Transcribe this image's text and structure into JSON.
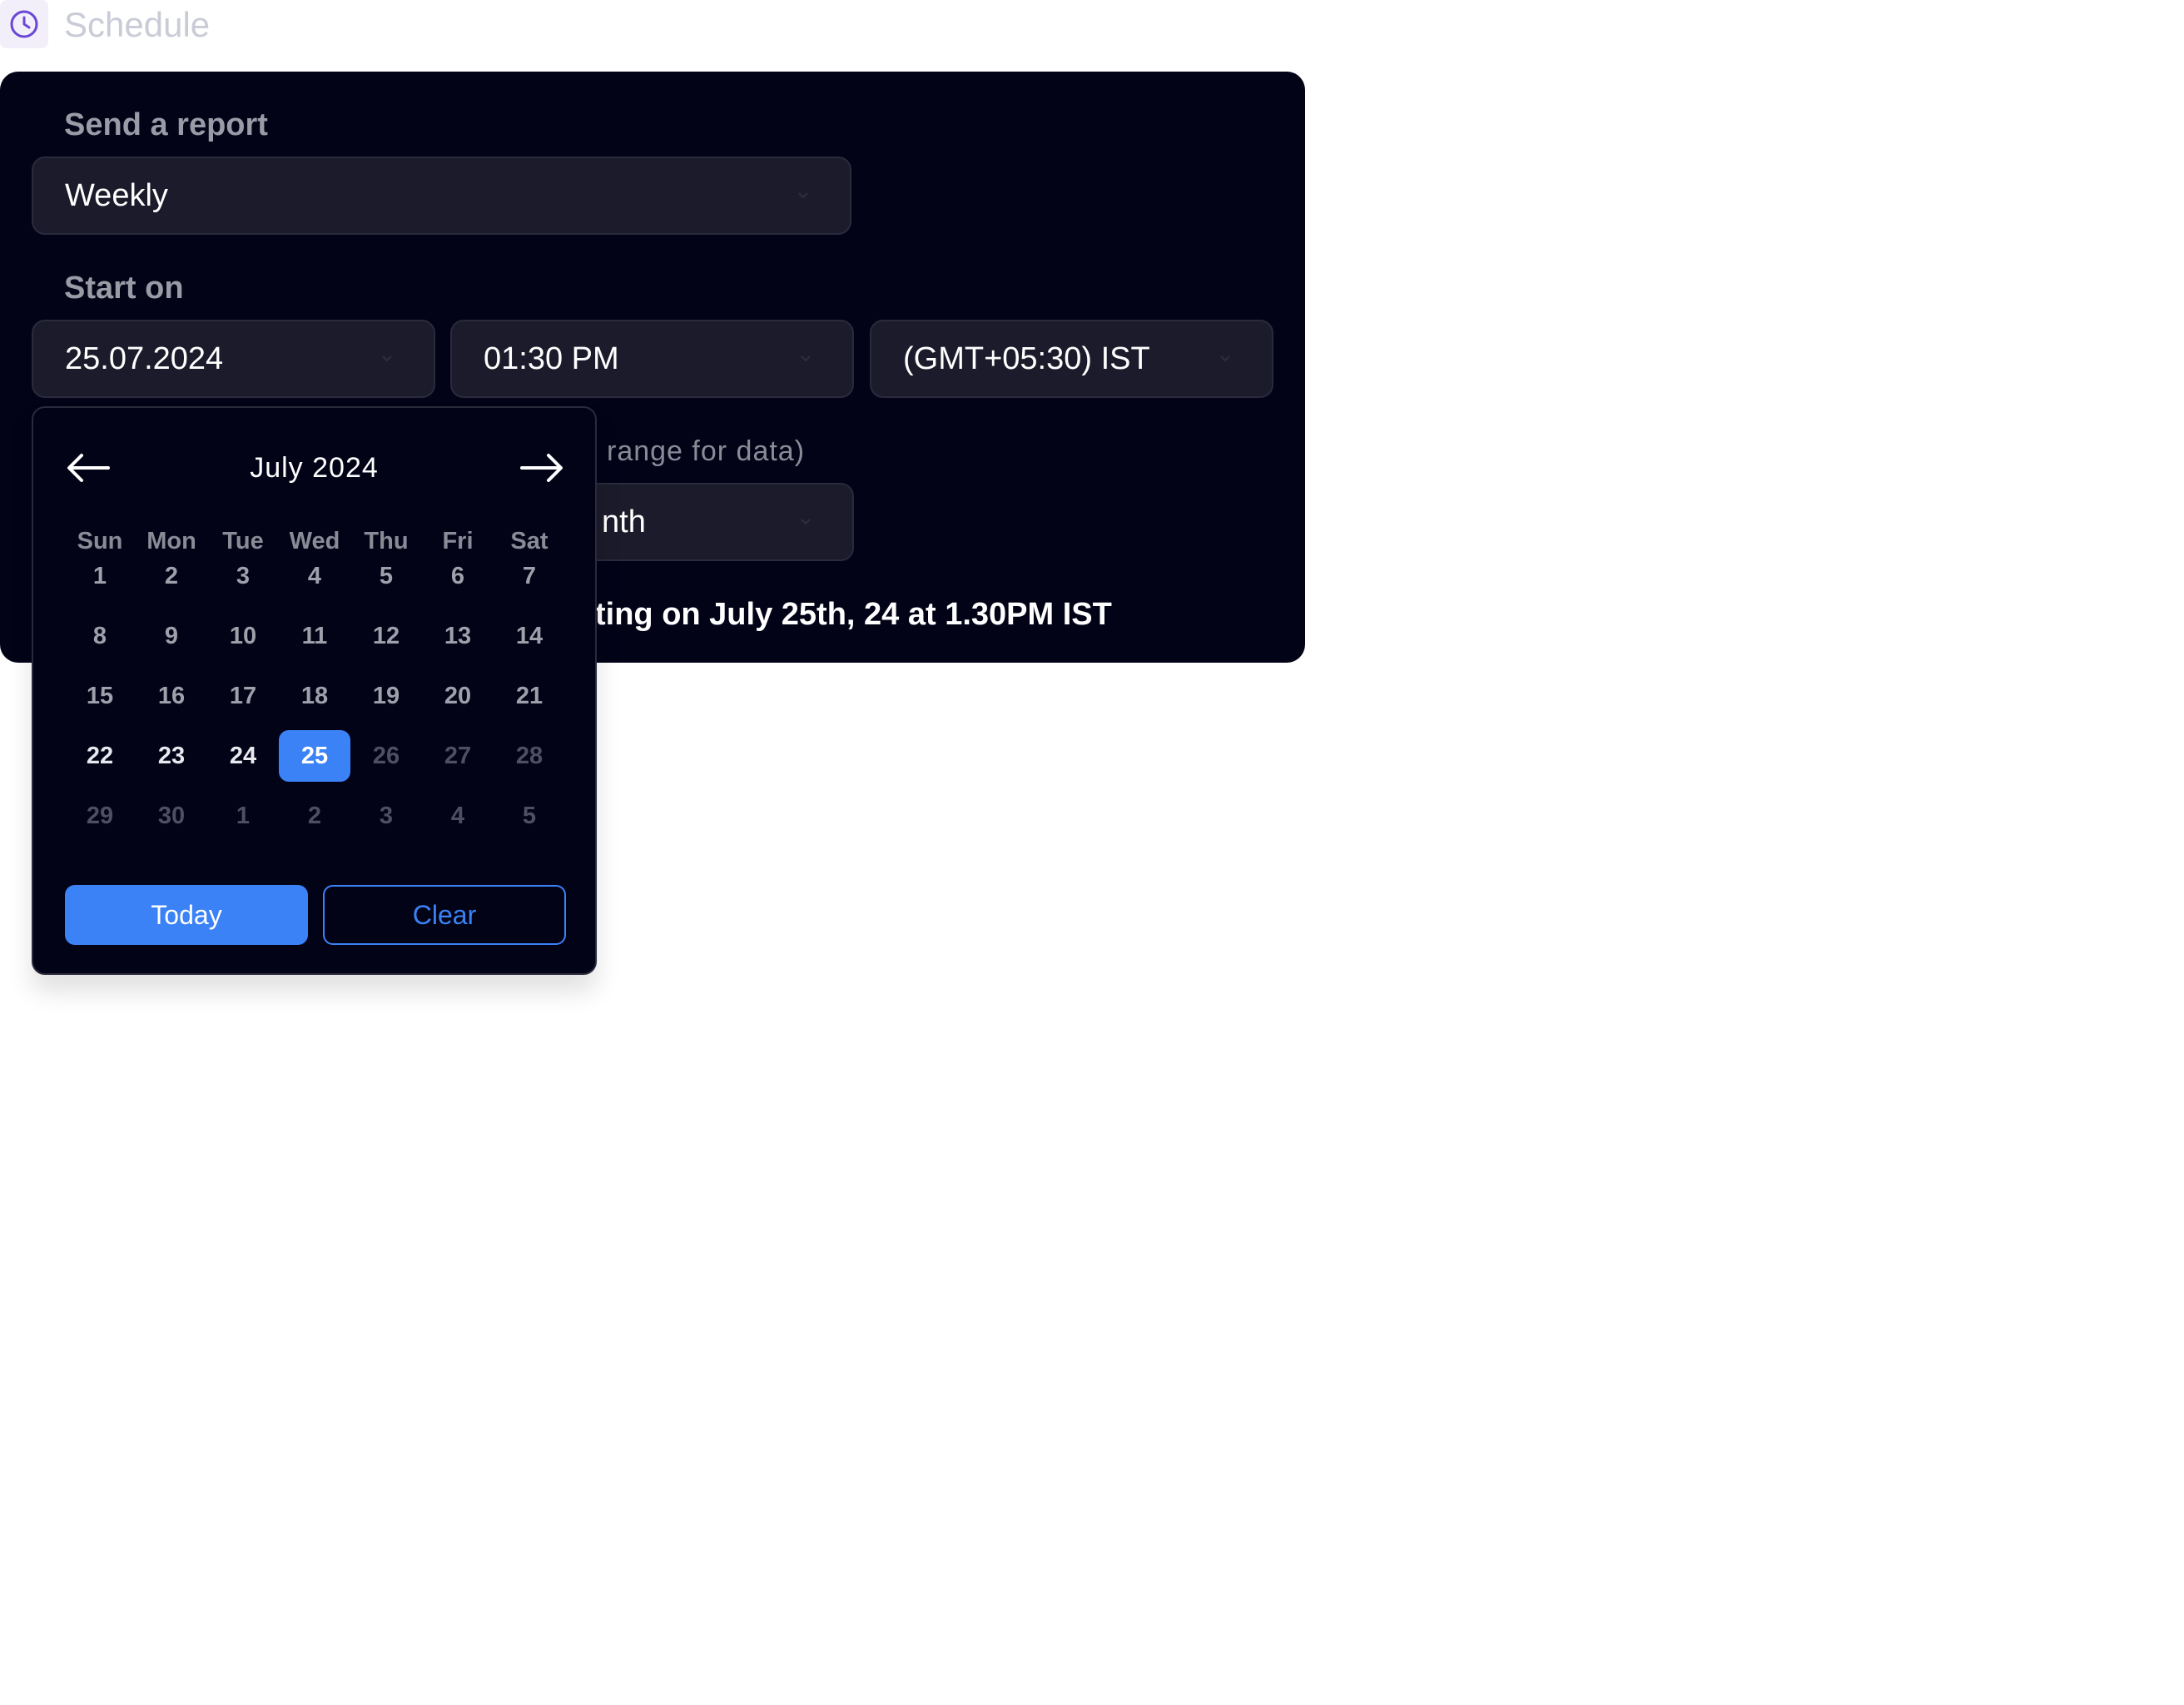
{
  "header": {
    "icon": "clock-icon",
    "title": "Schedule",
    "accent": "#6b46d6"
  },
  "form": {
    "send_label": "Send a report",
    "frequency_value": "Weekly",
    "start_label": "Start on",
    "date_value": "25.07.2024",
    "time_value": "01:30 PM",
    "timezone_value": "(GMT+05:30) IST",
    "range_label_partial": "range for data)",
    "range_value_partial": "nth",
    "summary_partial": "ting on July 25th, 24 at 1.30PM IST"
  },
  "calendar": {
    "month_title": "July 2024",
    "prev_icon": "arrow-left-icon",
    "next_icon": "arrow-right-icon",
    "weekdays": [
      "Sun",
      "Mon",
      "Tue",
      "Wed",
      "Thu",
      "Fri",
      "Sat"
    ],
    "weeks": [
      [
        "1",
        "2",
        "3",
        "4",
        "5",
        "6",
        "7"
      ],
      [
        "8",
        "9",
        "10",
        "11",
        "12",
        "13",
        "14"
      ],
      [
        "15",
        "16",
        "17",
        "18",
        "19",
        "20",
        "21"
      ],
      [
        "22",
        "23",
        "24",
        "25",
        "26",
        "27",
        "28"
      ],
      [
        "29",
        "30",
        "1",
        "2",
        "3",
        "4",
        "5"
      ]
    ],
    "selected_day": "25",
    "today_label": "Today",
    "clear_label": "Clear",
    "accent": "#3b82f6"
  }
}
